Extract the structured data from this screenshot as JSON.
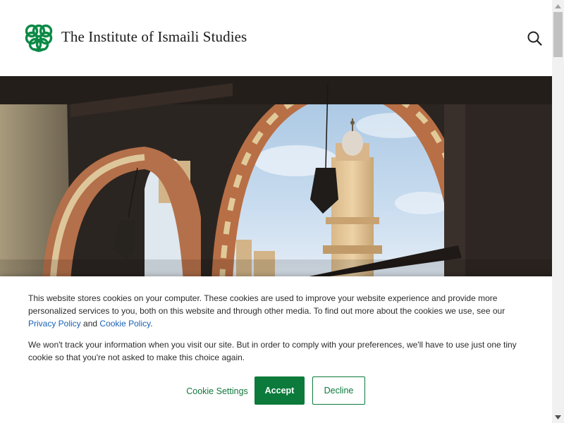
{
  "header": {
    "site_title": "The Institute of Ismaili Studies",
    "logo_icon": "iis-knot-logo-icon",
    "search_icon": "search-icon"
  },
  "hero": {
    "image": "mosque-archway-minaret-photo"
  },
  "cookie_banner": {
    "paragraph1_text": "This website stores cookies on your computer. These cookies are used to improve your website experience and provide more personalized services to you, both on this website and through other media. To find out more about the cookies we use, see our",
    "privacy_policy_link": "Privacy Policy",
    "and_text": "and",
    "cookie_policy_link": "Cookie Policy",
    "period": ".",
    "paragraph2_text": "We won't track your information when you visit our site. But in order to comply with your preferences, we'll have to use just one tiny cookie so that you're not asked to make this choice again.",
    "settings_label": "Cookie Settings",
    "accept_label": "Accept",
    "decline_label": "Decline"
  },
  "colors": {
    "brand_green": "#0b7a3b",
    "link_blue": "#1a62b3",
    "text": "#2b2b2b"
  }
}
